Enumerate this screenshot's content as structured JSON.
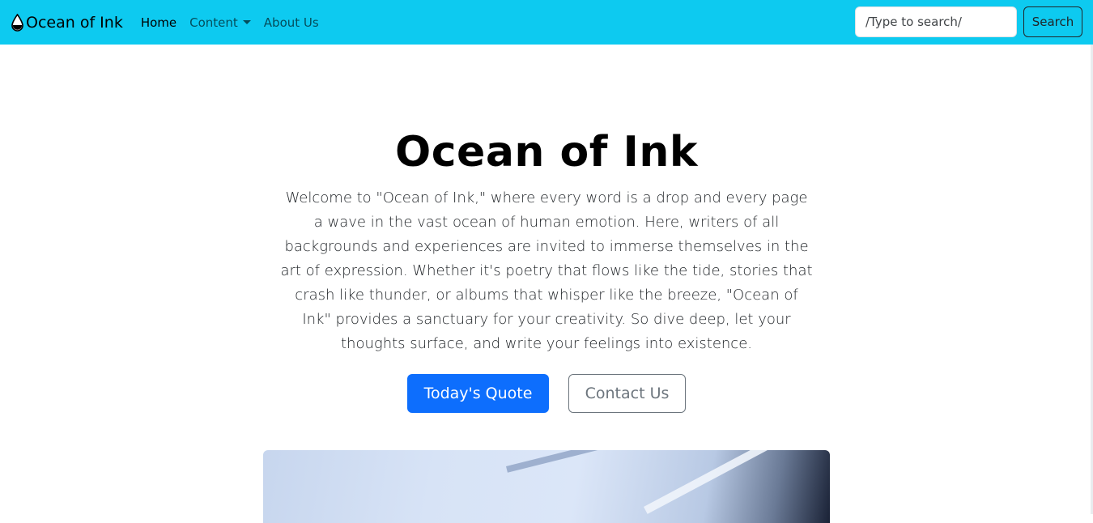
{
  "nav": {
    "brand": "Ocean of Ink",
    "links": [
      {
        "label": "Home",
        "active": true
      },
      {
        "label": "Content",
        "dropdown": true
      },
      {
        "label": "About Us"
      }
    ],
    "search_placeholder": "/Type to search/",
    "search_button": "Search",
    "bg_color": "#0dcaf0"
  },
  "hero": {
    "title": "Ocean of Ink",
    "description": "Welcome to \"Ocean of Ink,\" where every word is a drop and every page a wave in the vast ocean of human emotion. Here, writers of all backgrounds and experiences are invited to immerse themselves in the art of expression. Whether it's poetry that flows like the tide, stories that crash like thunder, or albums that whisper like the breeze, \"Ocean of Ink\" provides a sanctuary for your creativity. So dive deep, let your thoughts surface, and write your feelings into existence.",
    "primary_button": "Today's Quote",
    "secondary_button": "Contact Us",
    "primary_color": "#0d6efd"
  }
}
